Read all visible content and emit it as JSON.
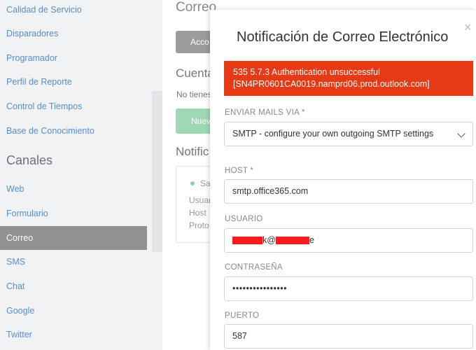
{
  "sidebar": {
    "items": [
      {
        "label": "Calidad de Servicio"
      },
      {
        "label": "Disparadores"
      },
      {
        "label": "Programador"
      },
      {
        "label": "Perfil de Reporte"
      },
      {
        "label": "Control de Tiempos"
      },
      {
        "label": "Base de Conocimiento"
      }
    ],
    "section_title": "Canales",
    "channels": [
      {
        "label": "Web"
      },
      {
        "label": "Formulario"
      },
      {
        "label": "Correo",
        "active": true
      },
      {
        "label": "SMS"
      },
      {
        "label": "Chat"
      },
      {
        "label": "Google"
      },
      {
        "label": "Twitter"
      }
    ]
  },
  "main": {
    "title": "Correo",
    "account_button": "Acco",
    "accounts_heading": "Cuenta",
    "no_accounts_text": "No tienes",
    "new_button": "Nuev",
    "notifications_heading": "Notific",
    "card": {
      "status": "Sa",
      "line1": "Usuar",
      "line2": "Host",
      "line3": "Proto"
    }
  },
  "modal": {
    "title": "Notificación de Correo Electrónico",
    "close_symbol": "×",
    "error_message": "535 5.7.3 Authentication unsuccessful [SN4PR0601CA0019.namprd06.prod.outlook.com]",
    "send_via_label": "ENVIAR MAILS VIA *",
    "send_via_value": "SMTP - configure your own outgoing SMTP settings",
    "host_label": "HOST *",
    "host_value": "smtp.office365.com",
    "user_label": "USUARIO",
    "user_prefix": "k@",
    "user_suffix": "e",
    "password_label": "CONTRASEÑA",
    "password_value": "••••••••••••••••",
    "port_label": "PUERTO",
    "port_value": "587"
  },
  "colors": {
    "error": "#e53a14",
    "redaction": "#ff1b1b",
    "active_nav": "#8f9193",
    "link": "#5a8ec9"
  }
}
